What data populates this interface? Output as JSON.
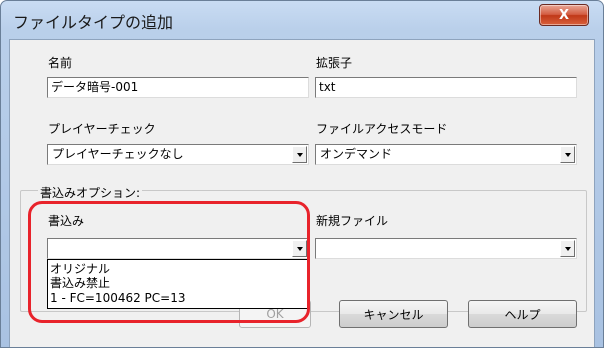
{
  "window": {
    "title": "ファイルタイプの追加",
    "close_label": "X"
  },
  "fields": {
    "name_label": "名前",
    "name_value": "データ暗号-001",
    "ext_label": "拡張子",
    "ext_value": "txt",
    "player_check_label": "プレイヤーチェック",
    "player_check_value": "プレイヤーチェックなし",
    "access_mode_label": "ファイルアクセスモード",
    "access_mode_value": "オンデマンド"
  },
  "write_options": {
    "group_label": "書込みオプション:",
    "write_label": "書込み",
    "write_value": "",
    "write_options_list": [
      "オリジナル",
      "書込み禁止",
      "1 - FC=100462 PC=13"
    ],
    "new_file_label": "新規ファイル",
    "new_file_value": ""
  },
  "buttons": {
    "ok": "OK",
    "cancel": "キャンセル",
    "help": "ヘルプ"
  },
  "colors": {
    "highlight": "#e8232b",
    "close_button": "#c94a2e",
    "window_frame": "#b9cfea"
  }
}
